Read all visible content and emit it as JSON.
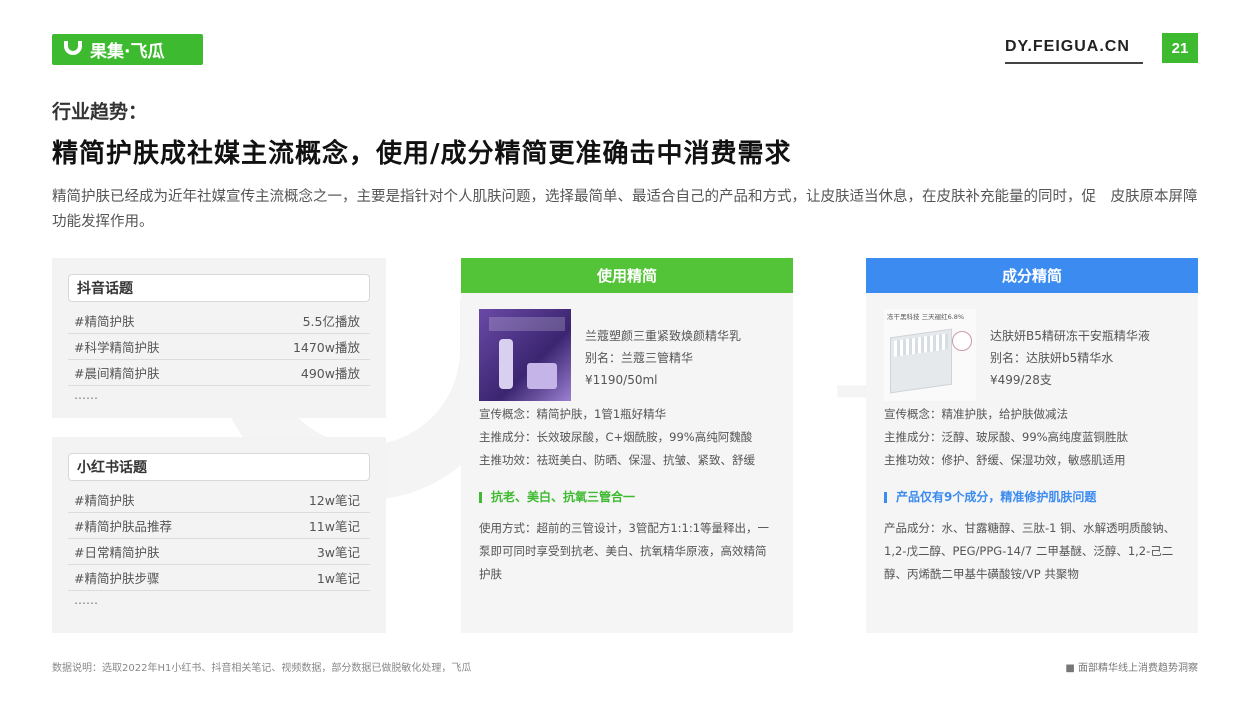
{
  "header": {
    "logo_text": "果集·飞瓜",
    "site": "DY.FEIGUA.CN",
    "page_number": "21",
    "brand_color": "#3dba2f"
  },
  "subtitle": "行业趋势：",
  "title": "精简护肤成社媒主流概念，使用/成分精简更准确击中消费需求",
  "description": "精简护肤已经成为近年社媒宣传主流概念之一，主要是指针对个人肌肤问题，选择最简单、最适合自己的产品和方式，让皮肤适当休息，在皮肤补充能量的同时，促　皮肤原本屏障功能发挥作用。",
  "watermark": "果集·飞瓜",
  "douyin": {
    "heading": "抖音话题",
    "rows": [
      {
        "tag": "#精简护肤",
        "value": "5.5亿播放"
      },
      {
        "tag": "#科学精简护肤",
        "value": "1470w播放"
      },
      {
        "tag": "#晨间精简护肤",
        "value": "490w播放"
      }
    ],
    "more": "……"
  },
  "xiaohongshu": {
    "heading": "小红书话题",
    "rows": [
      {
        "tag": "#精简护肤",
        "value": "12w笔记"
      },
      {
        "tag": "#精简护肤品推荐",
        "value": "11w笔记"
      },
      {
        "tag": "#日常精简护肤",
        "value": "3w笔记"
      },
      {
        "tag": "#精简护肤步骤",
        "value": "1w笔记"
      }
    ],
    "more": "……"
  },
  "use_card": {
    "header": "使用精简",
    "product_name": "兰蔻塑颜三重紧致焕颜精华乳",
    "alias": "别名：兰蔻三管精华",
    "price": "¥1190/50ml",
    "concept": "宣传概念：精简护肤，1管1瓶好精华",
    "ingredients": "主推成分：长效玻尿酸，C+烟酰胺，99%高纯阿魏酸",
    "efficacy": "主推功效：祛斑美白、防晒、保湿、抗皱、紧致、舒缓",
    "highlight": "抗老、美白、抗氧三管合一",
    "usage": "使用方式：超前的三管设计，3管配方1:1:1等量释出，一泵即可同时享受到抗老、美白、抗氧精华原液，高效精简护肤",
    "accent": "#53c437"
  },
  "ingredient_card": {
    "header": "成分精简",
    "image_caption": "冻干黑科技 三天褪红6.8%",
    "product_name": "达肤妍B5精研冻干安瓶精华液",
    "alias": "别名：达肤妍b5精华水",
    "price": "¥499/28支",
    "concept": "宣传概念：精准护肤，给护肤做减法",
    "ingredients": "主推成分：泛醇、玻尿酸、99%高纯度蓝铜胜肽",
    "efficacy": "主推功效：修护、舒缓、保湿功效，敏感肌适用",
    "highlight": "产品仅有9个成分，精准修护肌肤问题",
    "composition": "产品成分：水、甘露糖醇、三肽-1 铜、水解透明质酸钠、1,2-戊二醇、PEG/PPG-14/7 二甲基醚、泛醇、1,2-己二醇、丙烯酰二甲基牛磺酸铵/VP 共聚物",
    "accent": "#3b8bf0"
  },
  "footnote": "数据说明：选取2022年H1小红书、抖音相关笔记、视频数据，部分数据已做脱敏化处理，飞瓜",
  "source": "■ 面部精华线上消费趋势洞察"
}
